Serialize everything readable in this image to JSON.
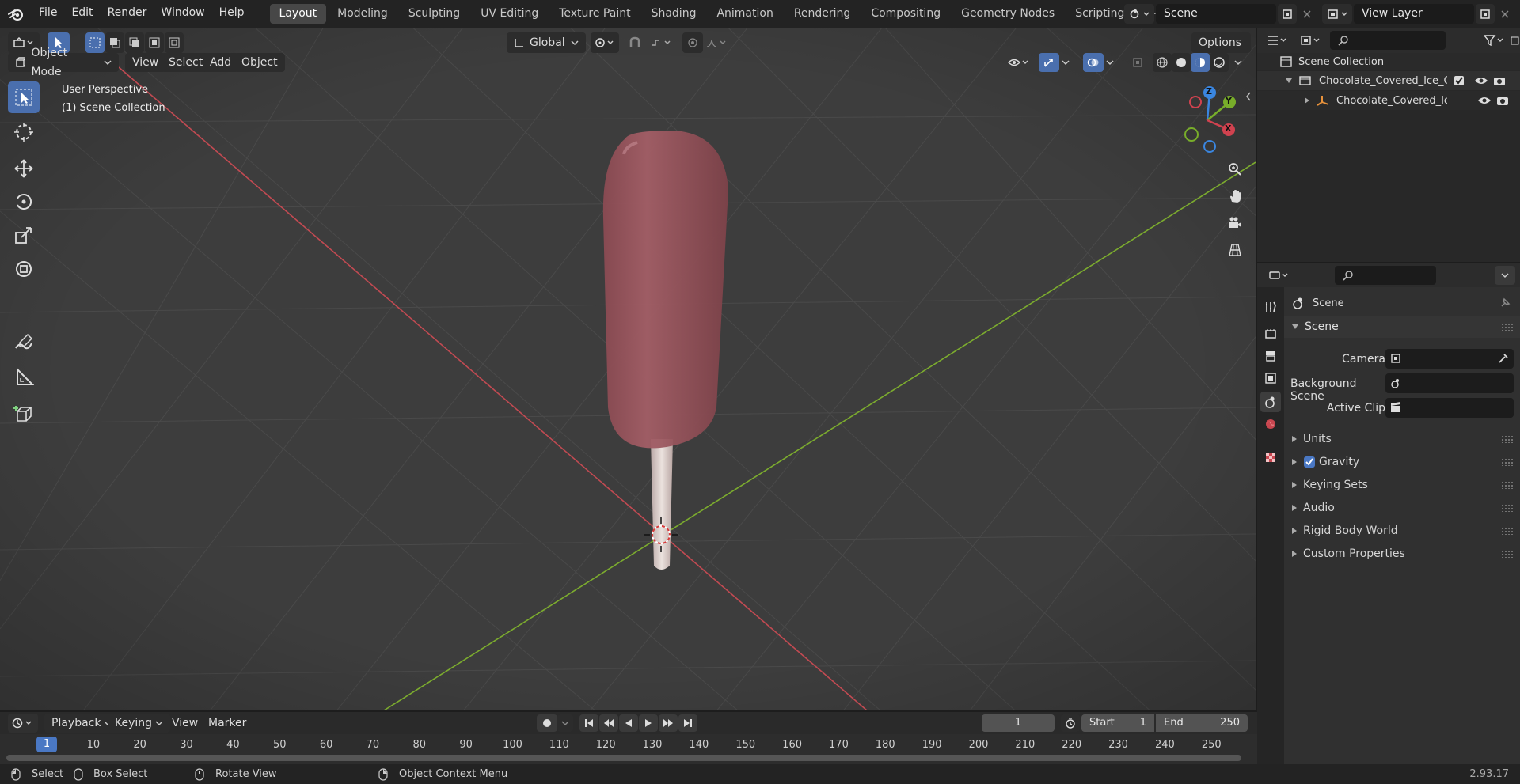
{
  "menus": [
    "File",
    "Edit",
    "Render",
    "Window",
    "Help"
  ],
  "workspaces": [
    "Layout",
    "Modeling",
    "Sculpting",
    "UV Editing",
    "Texture Paint",
    "Shading",
    "Animation",
    "Rendering",
    "Compositing",
    "Geometry Nodes",
    "Scripting"
  ],
  "active_workspace": "Layout",
  "scene_name": "Scene",
  "view_layer": "View Layer",
  "viewport": {
    "mode": "Object Mode",
    "menu": [
      "View",
      "Select",
      "Add",
      "Object"
    ],
    "transform_orientation": "Global",
    "options_label": "Options",
    "overlay_title": "User Perspective",
    "overlay_collection": "(1) Scene Collection",
    "axes": {
      "x": "X",
      "y": "Y",
      "z": "Z"
    },
    "colors": {
      "x_axis": "#d0424f",
      "y_axis": "#78ad2a",
      "z_axis": "#3a86e0",
      "bg": "#3d3d3d",
      "grid": "#4b4b4b"
    }
  },
  "outliner": {
    "root": "Scene Collection",
    "items": [
      {
        "label": "Chocolate_Covered_Ice_Crea",
        "type": "collection"
      },
      {
        "label": "Chocolate_Covered_Ice_(",
        "type": "object"
      }
    ]
  },
  "properties": {
    "context": "Scene",
    "panel": "Scene",
    "camera_label": "Camera",
    "background_label": "Background Scene",
    "active_clip_label": "Active Clip",
    "sections": [
      "Units",
      "Gravity",
      "Keying Sets",
      "Audio",
      "Rigid Body World",
      "Custom Properties"
    ],
    "gravity_checked": true
  },
  "timeline": {
    "menus": [
      "Playback",
      "Keying",
      "View",
      "Marker"
    ],
    "current_frame": "1",
    "start_label": "Start",
    "start": "1",
    "end_label": "End",
    "end": "250",
    "ticks": [
      "1",
      "10",
      "20",
      "30",
      "40",
      "50",
      "60",
      "70",
      "80",
      "90",
      "100",
      "110",
      "120",
      "130",
      "140",
      "150",
      "160",
      "170",
      "180",
      "190",
      "200",
      "210",
      "220",
      "230",
      "240",
      "250"
    ]
  },
  "status": {
    "select": "Select",
    "box_select": "Box Select",
    "rotate_view": "Rotate View",
    "context_menu": "Object Context Menu",
    "version": "2.93.17"
  }
}
